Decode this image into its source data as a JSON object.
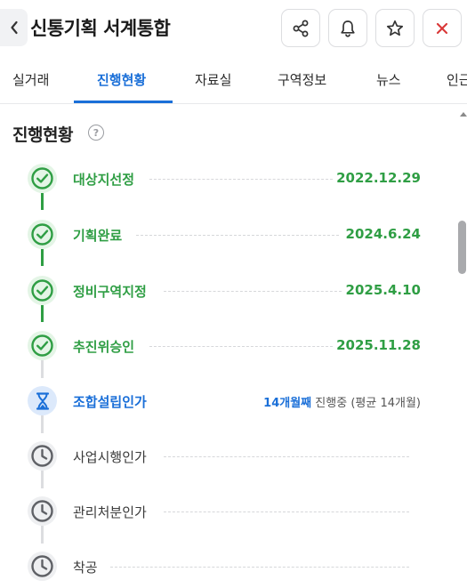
{
  "header": {
    "title": "신통기획 서계통합"
  },
  "tabs": [
    "실거래",
    "진행현황",
    "자료실",
    "구역정보",
    "뉴스",
    "인근"
  ],
  "active_tab": "진행현황",
  "section": {
    "title": "진행현황",
    "help_glyph": "?"
  },
  "steps": [
    {
      "label": "대상지선정",
      "date": "2022.12.29",
      "state": "done"
    },
    {
      "label": "기획완료",
      "date": "2024.6.24",
      "state": "done"
    },
    {
      "label": "정비구역지정",
      "date": "2025.4.10",
      "state": "done"
    },
    {
      "label": "추진위승인",
      "date": "2025.11.28",
      "state": "done"
    },
    {
      "label": "조합설립인가",
      "state": "current",
      "status_highlight": "14개월째",
      "status_text": "진행중",
      "status_avg": "(평균 14개월)"
    },
    {
      "label": "사업시행인가",
      "state": "pending"
    },
    {
      "label": "관리처분인가",
      "state": "pending"
    },
    {
      "label": "착공",
      "state": "pending"
    }
  ],
  "colors": {
    "accent_blue": "#1a6fd8",
    "done_green": "#2f9e44",
    "close_red": "#d93838",
    "pending_gray": "#5f6166"
  },
  "icons": {
    "back": "chevron-left-icon",
    "share": "share-icon",
    "bell": "bell-icon",
    "star": "star-icon",
    "close": "close-icon",
    "done": "check-circle-icon",
    "current": "hourglass-icon",
    "pending": "clock-icon"
  }
}
